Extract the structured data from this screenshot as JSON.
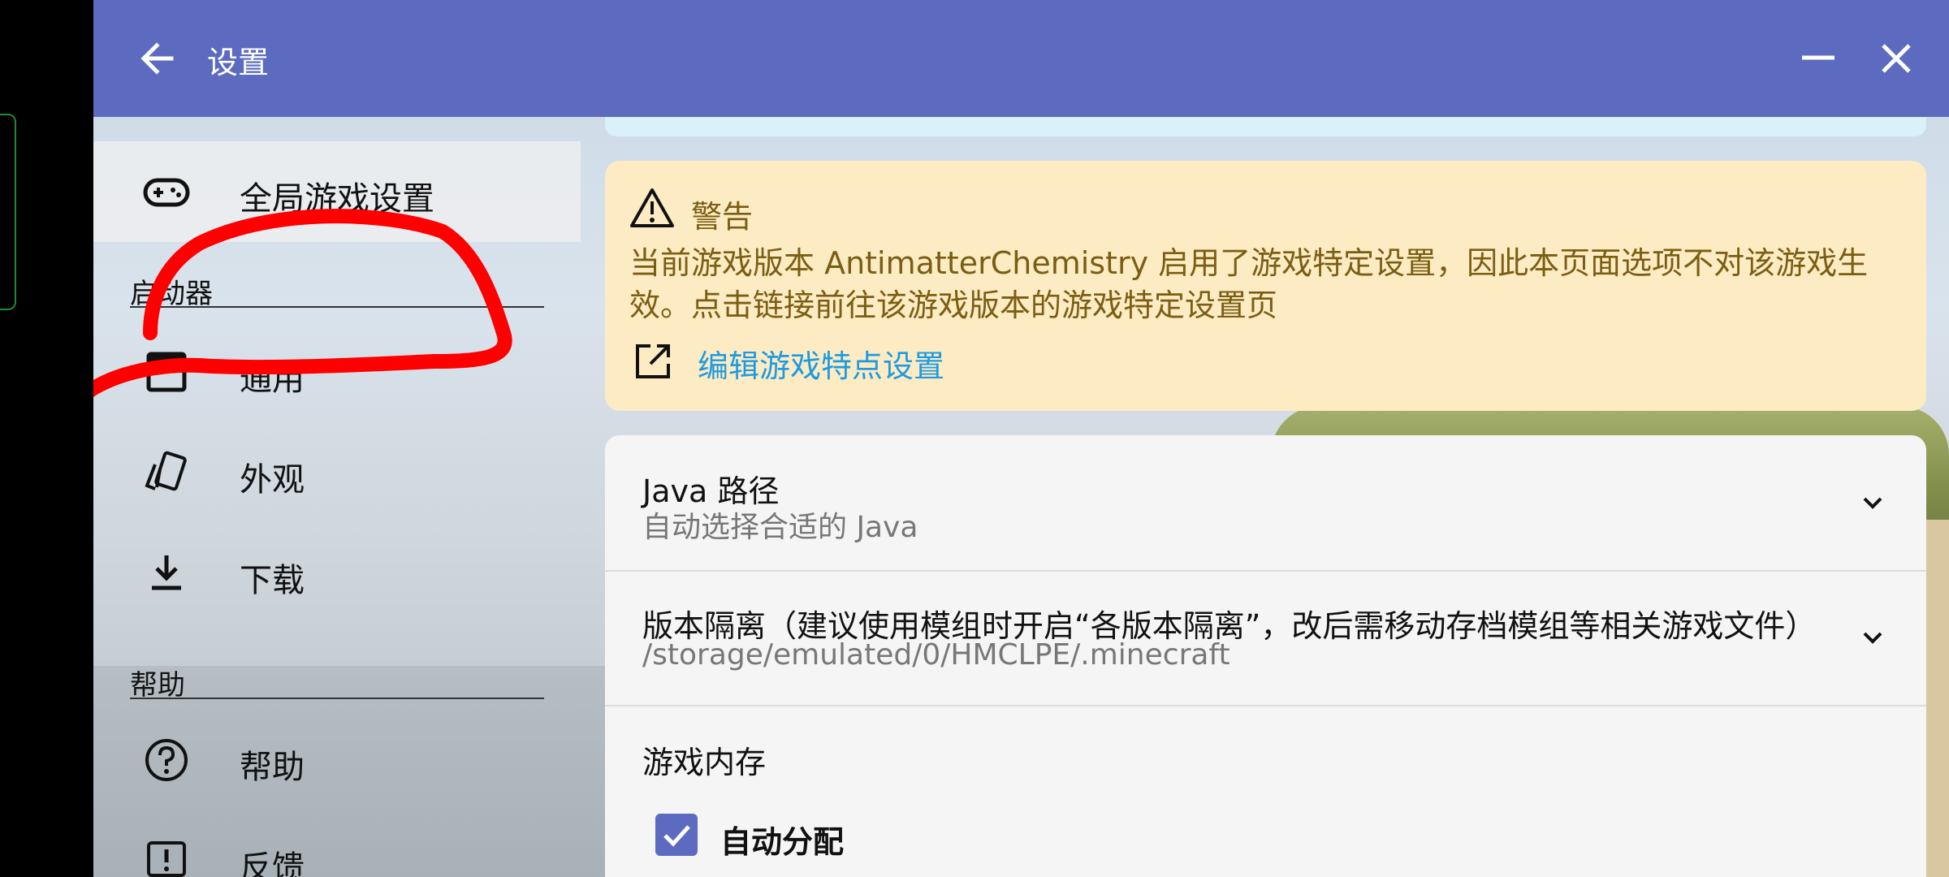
{
  "titlebar": {
    "title": "设置"
  },
  "sidebar": {
    "global_settings": "全局游戏设置",
    "section_launcher": "启动器",
    "launcher_items": [
      {
        "label": "通用"
      },
      {
        "label": "外观"
      },
      {
        "label": "下载"
      }
    ],
    "section_help": "帮助",
    "help_items": [
      {
        "label": "帮助"
      },
      {
        "label": "反馈"
      }
    ]
  },
  "warning": {
    "heading": "警告",
    "body": "当前游戏版本 AntimatterChemistry 启用了游戏特定设置，因此本页面选项不对该游戏生效。点击链接前往该游戏版本的游戏特定设置页",
    "link": "编辑游戏特点设置"
  },
  "settings": {
    "java_path": {
      "title": "Java 路径",
      "value": "自动选择合适的 Java"
    },
    "isolation": {
      "title": "版本隔离（建议使用模组时开启“各版本隔离”，改后需移动存档模组等相关游戏文件）",
      "value": "/storage/emulated/0/HMCLPE/.minecraft"
    },
    "memory": {
      "title": "游戏内存",
      "auto_allocate": "自动分配",
      "auto_allocate_checked": true
    }
  },
  "colors": {
    "titlebar": "#5c6bc0",
    "warning_bg": "#fdebc3",
    "warning_text": "#7a5e12",
    "link": "#1e9be0",
    "annotation": "#ff0000"
  }
}
